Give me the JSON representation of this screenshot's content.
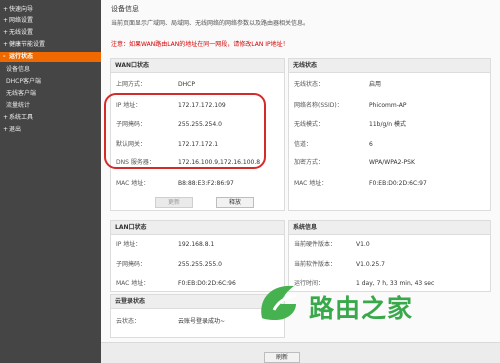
{
  "sidebar": {
    "items": [
      {
        "label": "快速向导",
        "marker": "+",
        "type": "top"
      },
      {
        "label": "网络设置",
        "marker": "+",
        "type": "top"
      },
      {
        "label": "无线设置",
        "marker": "+",
        "type": "top"
      },
      {
        "label": "健康节能设置",
        "marker": "+",
        "type": "top"
      },
      {
        "label": "运行状态",
        "marker": "-",
        "type": "active"
      },
      {
        "label": "设备信息",
        "marker": "",
        "type": "sub"
      },
      {
        "label": "DHCP客户端",
        "marker": "",
        "type": "sub"
      },
      {
        "label": "无线客户端",
        "marker": "",
        "type": "sub"
      },
      {
        "label": "流量统计",
        "marker": "",
        "type": "sub"
      },
      {
        "label": "系统工具",
        "marker": "+",
        "type": "top"
      },
      {
        "label": "退出",
        "marker": "+",
        "type": "top"
      }
    ]
  },
  "main": {
    "title": "设备信息",
    "intro": "当前页面显示广域网、局域网、无线网络的网络参数以及路由器相关信息。",
    "warning": "注意：如果WAN路由LAN的地址在同一网段，请修改LAN IP地址！"
  },
  "wan": {
    "header": "WAN口状态",
    "rows": [
      {
        "label": "上网方式：",
        "value": "DHCP"
      },
      {
        "label": "IP 地址：",
        "value": "172.17.172.109"
      },
      {
        "label": "子网掩码：",
        "value": "255.255.254.0"
      },
      {
        "label": "默认网关：",
        "value": "172.17.172.1"
      },
      {
        "label": "DNS 服务器：",
        "value": "172.16.100.9,172.16.100.8"
      },
      {
        "label": "MAC 地址：",
        "value": "B8:88:E3:F2:86:97"
      }
    ],
    "renew_label": "更新",
    "release_label": "释放"
  },
  "wireless": {
    "header": "无线状态",
    "rows": [
      {
        "label": "无线状态：",
        "value": "启用"
      },
      {
        "label": "网络名称(SSID)：",
        "value": "Phicomm-AP"
      },
      {
        "label": "无线模式：",
        "value": "11b/g/n 模式"
      },
      {
        "label": "信道：",
        "value": "6"
      },
      {
        "label": "加密方式：",
        "value": "WPA/WPA2-PSK"
      },
      {
        "label": "MAC 地址：",
        "value": "F0:EB:D0:2D:6C:97"
      }
    ]
  },
  "lan": {
    "header": "LAN口状态",
    "rows": [
      {
        "label": "IP 地址：",
        "value": "192.168.8.1"
      },
      {
        "label": "子网掩码：",
        "value": "255.255.255.0"
      },
      {
        "label": "MAC 地址：",
        "value": "F0:EB:D0:2D:6C:96"
      }
    ]
  },
  "system": {
    "header": "系统信息",
    "rows": [
      {
        "label": "当前硬件版本：",
        "value": "V1.0"
      },
      {
        "label": "当前软件版本：",
        "value": "V1.0.25.7"
      },
      {
        "label": "运行时间：",
        "value": "1 day, 7 h, 33 min, 43 sec"
      }
    ]
  },
  "cloud": {
    "header": "云登录状态",
    "rows": [
      {
        "label": "云状态：",
        "value": "云账号登录成功~"
      }
    ]
  },
  "footer": {
    "refresh_label": "刷新"
  },
  "watermark": {
    "text": "路由之家",
    "color": "#39a84a"
  },
  "colors": {
    "sidebar_bg": "#454545",
    "active_bg": "#ef6900",
    "warning": "#d40000",
    "highlight": "#d52a2a"
  }
}
